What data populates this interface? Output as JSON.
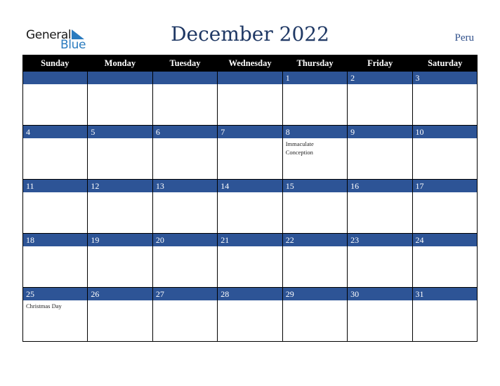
{
  "brand": {
    "line1": "General",
    "line2": "Blue"
  },
  "title": "December 2022",
  "country": "Peru",
  "colors": {
    "header_bg": "#000000",
    "date_band": "#2d5496",
    "title": "#1f3864"
  },
  "weekdays": [
    "Sunday",
    "Monday",
    "Tuesday",
    "Wednesday",
    "Thursday",
    "Friday",
    "Saturday"
  ],
  "weeks": [
    [
      {
        "day": "",
        "event": ""
      },
      {
        "day": "",
        "event": ""
      },
      {
        "day": "",
        "event": ""
      },
      {
        "day": "",
        "event": ""
      },
      {
        "day": "1",
        "event": ""
      },
      {
        "day": "2",
        "event": ""
      },
      {
        "day": "3",
        "event": ""
      }
    ],
    [
      {
        "day": "4",
        "event": ""
      },
      {
        "day": "5",
        "event": ""
      },
      {
        "day": "6",
        "event": ""
      },
      {
        "day": "7",
        "event": ""
      },
      {
        "day": "8",
        "event": "Immaculate Conception"
      },
      {
        "day": "9",
        "event": ""
      },
      {
        "day": "10",
        "event": ""
      }
    ],
    [
      {
        "day": "11",
        "event": ""
      },
      {
        "day": "12",
        "event": ""
      },
      {
        "day": "13",
        "event": ""
      },
      {
        "day": "14",
        "event": ""
      },
      {
        "day": "15",
        "event": ""
      },
      {
        "day": "16",
        "event": ""
      },
      {
        "day": "17",
        "event": ""
      }
    ],
    [
      {
        "day": "18",
        "event": ""
      },
      {
        "day": "19",
        "event": ""
      },
      {
        "day": "20",
        "event": ""
      },
      {
        "day": "21",
        "event": ""
      },
      {
        "day": "22",
        "event": ""
      },
      {
        "day": "23",
        "event": ""
      },
      {
        "day": "24",
        "event": ""
      }
    ],
    [
      {
        "day": "25",
        "event": "Christmas Day"
      },
      {
        "day": "26",
        "event": ""
      },
      {
        "day": "27",
        "event": ""
      },
      {
        "day": "28",
        "event": ""
      },
      {
        "day": "29",
        "event": ""
      },
      {
        "day": "30",
        "event": ""
      },
      {
        "day": "31",
        "event": ""
      }
    ]
  ]
}
